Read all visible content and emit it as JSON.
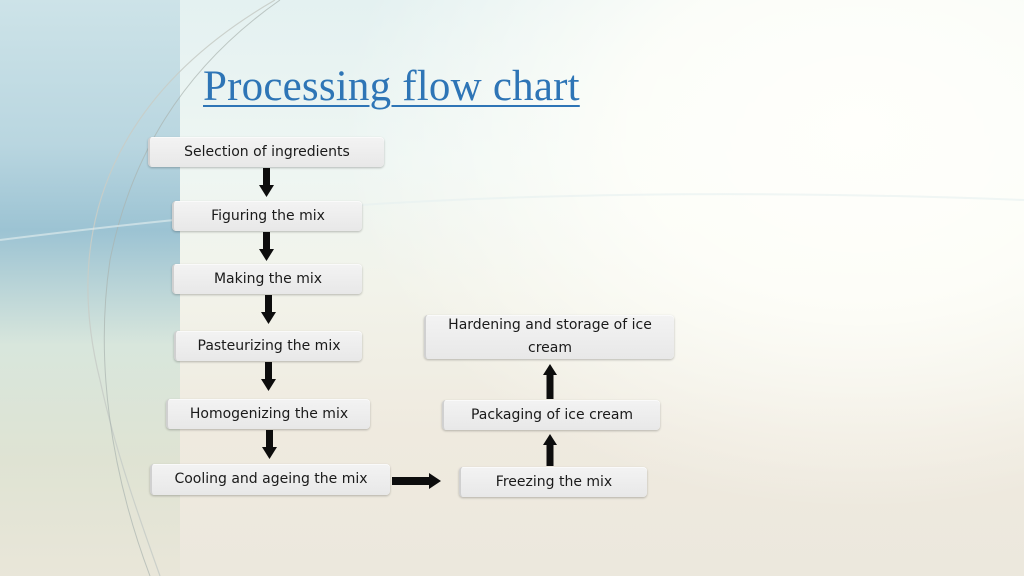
{
  "slide": {
    "title": "Processing flow chart",
    "colors": {
      "title": "#2e75b6",
      "box_fill": "#ececec",
      "box_text": "#1a1a1a",
      "arrow": "#0d0d0d"
    }
  },
  "flowchart": {
    "steps": [
      {
        "id": "selection",
        "label": "Selection of ingredients"
      },
      {
        "id": "figuring",
        "label": "Figuring the mix"
      },
      {
        "id": "making",
        "label": "Making the mix"
      },
      {
        "id": "pasteurizing",
        "label": "Pasteurizing the mix"
      },
      {
        "id": "homogenizing",
        "label": "Homogenizing the mix"
      },
      {
        "id": "cooling",
        "label": "Cooling and ageing the mix"
      },
      {
        "id": "freezing",
        "label": "Freezing the mix"
      },
      {
        "id": "packaging",
        "label": "Packaging of ice cream"
      },
      {
        "id": "hardening",
        "label": "Hardening and storage of ice cream"
      }
    ],
    "connections": [
      {
        "from": "selection",
        "to": "figuring",
        "direction": "down"
      },
      {
        "from": "figuring",
        "to": "making",
        "direction": "down"
      },
      {
        "from": "making",
        "to": "pasteurizing",
        "direction": "down"
      },
      {
        "from": "pasteurizing",
        "to": "homogenizing",
        "direction": "down"
      },
      {
        "from": "homogenizing",
        "to": "cooling",
        "direction": "down"
      },
      {
        "from": "cooling",
        "to": "freezing",
        "direction": "right"
      },
      {
        "from": "freezing",
        "to": "packaging",
        "direction": "up"
      },
      {
        "from": "packaging",
        "to": "hardening",
        "direction": "up"
      }
    ]
  }
}
